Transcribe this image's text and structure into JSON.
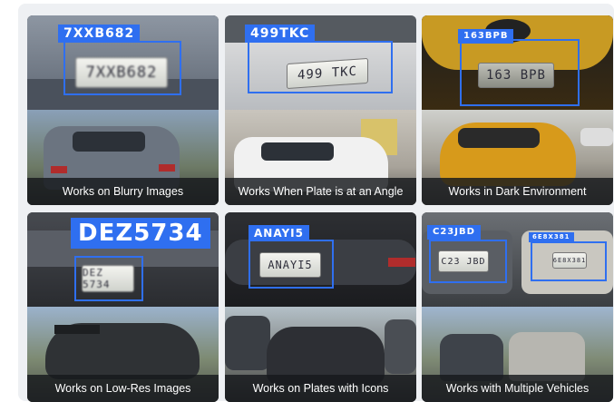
{
  "gallery": {
    "cards": [
      {
        "plate_text": "7XXB682",
        "image_plate": "7XXB682",
        "caption": "Works on Blurry Images"
      },
      {
        "plate_text": "499TKC",
        "image_plate": "499 TKC",
        "caption": "Works When Plate is at an Angle"
      },
      {
        "plate_text": "163BPB",
        "image_plate": "163 BPB",
        "caption": "Works in Dark Environment"
      },
      {
        "plate_text": "DEZ5734",
        "image_plate": "DEZ 5734",
        "caption": "Works on Low-Res Images"
      },
      {
        "plate_text": "ANAYI5",
        "image_plate": "ANAYI5",
        "caption": "Works on Plates with Icons"
      },
      {
        "plate_text": "C23JBD",
        "plate_text_2": "6E8X381",
        "image_plate": "C23 JBD",
        "image_plate_2": "6E8X381",
        "caption": "Works with Multiple Vehicles"
      }
    ]
  },
  "colors": {
    "accent": "#2f6ff0",
    "caption_bg": "#16181c",
    "panel_bg": "#eef0f3"
  }
}
